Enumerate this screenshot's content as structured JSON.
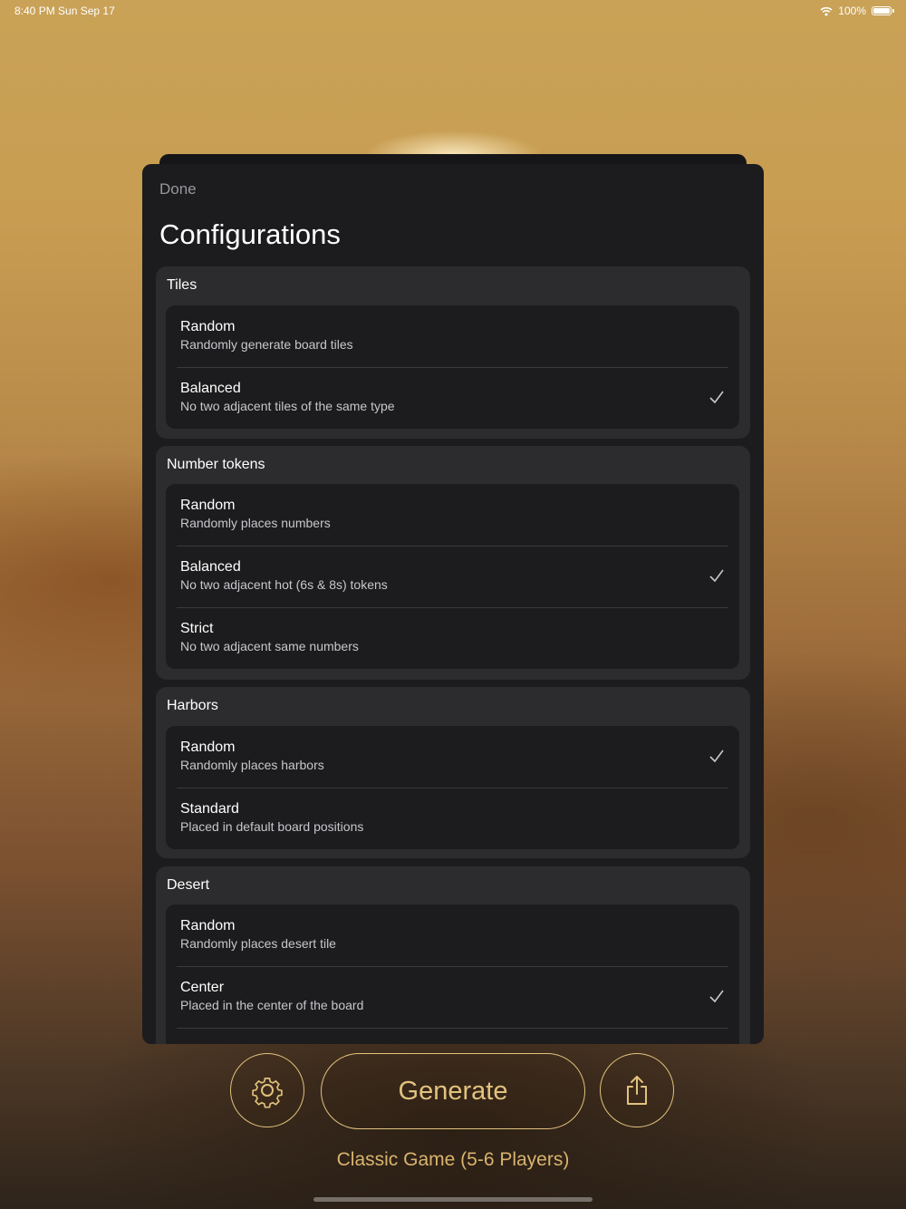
{
  "status_bar": {
    "time": "8:40 PM   Sun Sep 17",
    "battery": "100%"
  },
  "sheet": {
    "done_label": "Done",
    "title": "Configurations",
    "sections": [
      {
        "title": "Tiles",
        "options": [
          {
            "title": "Random",
            "subtitle": "Randomly generate board tiles",
            "selected": false
          },
          {
            "title": "Balanced",
            "subtitle": "No two adjacent tiles of the same type",
            "selected": true
          }
        ]
      },
      {
        "title": "Number tokens",
        "options": [
          {
            "title": "Random",
            "subtitle": "Randomly places numbers",
            "selected": false
          },
          {
            "title": "Balanced",
            "subtitle": "No two adjacent hot (6s & 8s) tokens",
            "selected": true
          },
          {
            "title": "Strict",
            "subtitle": "No two adjacent same numbers",
            "selected": false
          }
        ]
      },
      {
        "title": "Harbors",
        "options": [
          {
            "title": "Random",
            "subtitle": "Randomly places harbors",
            "selected": true
          },
          {
            "title": "Standard",
            "subtitle": "Placed in default board positions",
            "selected": false
          }
        ]
      },
      {
        "title": "Desert",
        "options": [
          {
            "title": "Random",
            "subtitle": "Randomly places desert tile",
            "selected": false
          },
          {
            "title": "Center",
            "subtitle": "Placed in the center of the board",
            "selected": true
          }
        ]
      }
    ]
  },
  "bottom": {
    "settings_icon": "gear-icon",
    "generate_label": "Generate",
    "share_icon": "share-icon",
    "game_mode": "Classic Game (5-6 Players)"
  },
  "colors": {
    "accent": "#e2c27e",
    "sheet_bg": "#1c1c1e",
    "section_bg": "#2c2c2e"
  }
}
